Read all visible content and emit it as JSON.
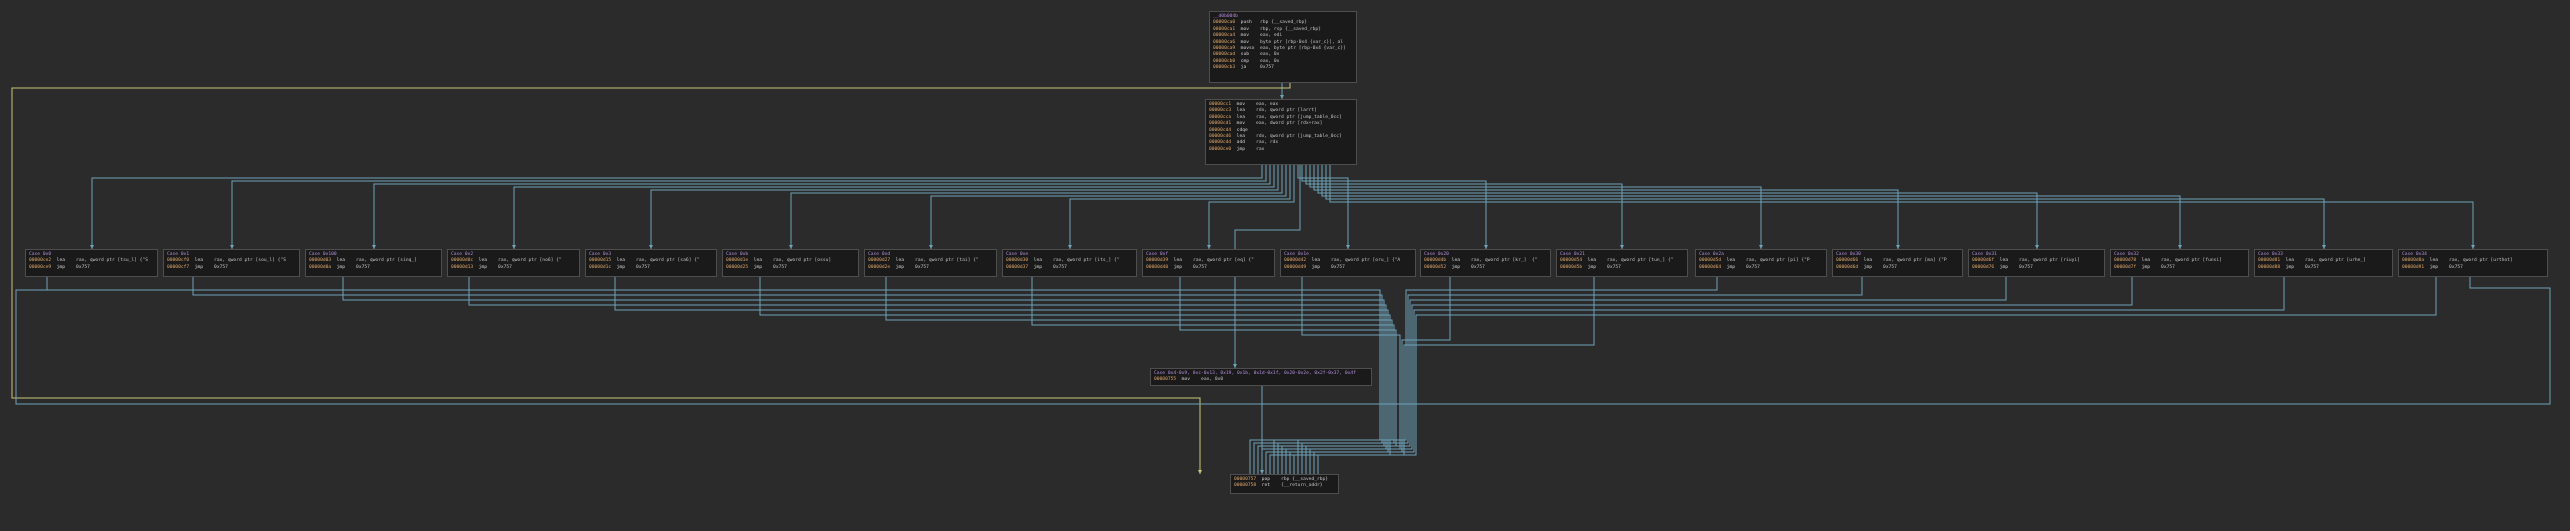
{
  "theme": {
    "background": "#2b2b2b",
    "block_background": "#1a1a1a",
    "block_border": "#4e4e4e",
    "edge_branch_color": "#6fa3b8",
    "edge_default_color": "#c8c87a",
    "address_color": "#e0a86a",
    "label_color": "#b58ee0",
    "variable_color": "#d07050"
  },
  "blocks": {
    "entry": {
      "label": "__d0b004b",
      "lines": [
        {
          "addr": "00000ca0",
          "mn": "push",
          "op": "rbp {__saved_rbp}"
        },
        {
          "addr": "00000ca1",
          "mn": "mov",
          "op": "rbp, rsp {__saved_rbp}"
        },
        {
          "addr": "00000ca4",
          "mn": "mov",
          "op": "eax, edi"
        },
        {
          "addr": "00000ca6",
          "mn": "mov",
          "op": "byte ptr [rbp-0x4 {var_c}], al"
        },
        {
          "addr": "00000ca9",
          "mn": "movsx",
          "op": "eax, byte ptr [rbp-0x4 {var_c}]"
        },
        {
          "addr": "00000cad",
          "mn": "sub",
          "op": "eax, 0x"
        },
        {
          "addr": "00000cb0",
          "mn": "cmp",
          "op": "eax, 0x"
        },
        {
          "addr": "00000cb3",
          "mn": "ja",
          "op": "0x757"
        }
      ]
    },
    "dispatch": {
      "label": "",
      "lines": [
        {
          "addr": "00000cc1",
          "mn": "mov",
          "op": "eax, eax"
        },
        {
          "addr": "00000cc3",
          "mn": "lea",
          "op": "rdx, qword ptr [larrt]"
        },
        {
          "addr": "00000cca",
          "mn": "lea",
          "op": "rax, qword ptr [jump_table_0cc]"
        },
        {
          "addr": "00000cd1",
          "mn": "mov",
          "op": "eax, dword ptr [rdx+rax]"
        },
        {
          "addr": "00000cd4",
          "mn": "cdqe",
          "op": ""
        },
        {
          "addr": "00000cd6",
          "mn": "lea",
          "op": "rdx, qword ptr [jump_table_0cc]"
        },
        {
          "addr": "00000cdd",
          "mn": "add",
          "op": "rax, rdx"
        },
        {
          "addr": "00000ce0",
          "mn": "jmp",
          "op": "rax"
        }
      ]
    },
    "merge": {
      "label": "Case 0x4-0x9, 0xc-0x13, 0x19, 0x1b, 0x1d-0x1f, 0x20-0x2e, 0x2f-0x37, 0x4f",
      "lines": [
        {
          "addr": "00000755",
          "mn": "mov",
          "op": "eax, 0x0"
        }
      ]
    },
    "exit": {
      "label": "",
      "lines": [
        {
          "addr": "00000757",
          "mn": "pop",
          "op": "rbp {__saved_rbp}"
        },
        {
          "addr": "00000758",
          "mn": "ret",
          "op": "{__return_addr}"
        }
      ]
    }
  },
  "cases": [
    {
      "label": "Case 0x0",
      "lines": [
        {
          "addr": "00000ce2",
          "mn": "lea",
          "op": "rax, qword ptr [tsu_l] {\"S"
        },
        {
          "addr": "00000ce9",
          "mn": "jmp",
          "op": "0x757"
        }
      ]
    },
    {
      "label": "Case 0x1",
      "lines": [
        {
          "addr": "00000cf0",
          "mn": "lea",
          "op": "rax, qword ptr [sou_l] {\"S"
        },
        {
          "addr": "00000cf7",
          "mn": "jmp",
          "op": "0x757"
        }
      ]
    },
    {
      "label": "Case 0x100",
      "lines": [
        {
          "addr": "00000d03",
          "mn": "lea",
          "op": "rax, qword ptr [sinq_]"
        },
        {
          "addr": "00000d0a",
          "mn": "jmp",
          "op": "0x757"
        }
      ]
    },
    {
      "label": "Case 0x2",
      "lines": [
        {
          "addr": "00000d0c",
          "mn": "lea",
          "op": "rax, qword ptr [no6] {\""
        },
        {
          "addr": "00000d13",
          "mn": "jmp",
          "op": "0x757"
        }
      ]
    },
    {
      "label": "Case 0x3",
      "lines": [
        {
          "addr": "00000d15",
          "mn": "lea",
          "op": "rax, qword ptr [sa6] {\""
        },
        {
          "addr": "00000d1c",
          "mn": "jmp",
          "op": "0x757"
        }
      ]
    },
    {
      "label": "Case 0xb",
      "lines": [
        {
          "addr": "00000d1e",
          "mn": "lea",
          "op": "rax, qword ptr [ossu]"
        },
        {
          "addr": "00000d25",
          "mn": "jmp",
          "op": "0x757"
        }
      ]
    },
    {
      "label": "Case 0xd",
      "lines": [
        {
          "addr": "00000d27",
          "mn": "lea",
          "op": "rax, qword ptr [tai] {\""
        },
        {
          "addr": "00000d2e",
          "mn": "jmp",
          "op": "0x757"
        }
      ]
    },
    {
      "label": "Case 0xe",
      "lines": [
        {
          "addr": "00000d30",
          "mn": "lea",
          "op": "rax, qword ptr [its_] {\""
        },
        {
          "addr": "00000d37",
          "mn": "jmp",
          "op": "0x757"
        }
      ]
    },
    {
      "label": "Case 0xf",
      "lines": [
        {
          "addr": "00000d39",
          "mn": "lea",
          "op": "rax, qword ptr [eq] {\""
        },
        {
          "addr": "00000d40",
          "mn": "jmp",
          "op": "0x757"
        }
      ]
    },
    {
      "label": "Case 0x1e",
      "lines": [
        {
          "addr": "00000d42",
          "mn": "lea",
          "op": "rax, qword ptr [oru_] {\"A"
        },
        {
          "addr": "00000d49",
          "mn": "jmp",
          "op": "0x757"
        }
      ]
    },
    {
      "label": "Case 0x20",
      "lines": [
        {
          "addr": "00000d4b",
          "mn": "lea",
          "op": "rax, qword ptr [kr_]  {\""
        },
        {
          "addr": "00000d52",
          "mn": "jmp",
          "op": "0x757"
        }
      ]
    },
    {
      "label": "Case 0x21",
      "lines": [
        {
          "addr": "00000d54",
          "mn": "lea",
          "op": "rax, qword ptr [tun_] {\""
        },
        {
          "addr": "00000d5b",
          "mn": "jmp",
          "op": "0x757"
        }
      ]
    },
    {
      "label": "Case 0x2a",
      "lines": [
        {
          "addr": "00000d5d",
          "mn": "lea",
          "op": "rax, qword ptr [pi] {\"P"
        },
        {
          "addr": "00000d64",
          "mn": "jmp",
          "op": "0x757"
        }
      ]
    },
    {
      "label": "Case 0x30",
      "lines": [
        {
          "addr": "00000d66",
          "mn": "lea",
          "op": "rax, qword ptr [ma] {\"P"
        },
        {
          "addr": "00000d6d",
          "mn": "jmp",
          "op": "0x757"
        }
      ]
    },
    {
      "label": "Case 0x31",
      "lines": [
        {
          "addr": "00000d6f",
          "mn": "lea",
          "op": "rax, qword ptr [riuyi]"
        },
        {
          "addr": "00000d76",
          "mn": "jmp",
          "op": "0x757"
        }
      ]
    },
    {
      "label": "Case 0x32",
      "lines": [
        {
          "addr": "00000d78",
          "mn": "lea",
          "op": "rax, qword ptr [funsi]"
        },
        {
          "addr": "00000d7f",
          "mn": "jmp",
          "op": "0x757"
        }
      ]
    },
    {
      "label": "Case 0x33",
      "lines": [
        {
          "addr": "00000d81",
          "mn": "lea",
          "op": "rax, qword ptr [urhe_]"
        },
        {
          "addr": "00000d88",
          "mn": "jmp",
          "op": "0x757"
        }
      ]
    },
    {
      "label": "Case 0x34",
      "lines": [
        {
          "addr": "00000d8a",
          "mn": "lea",
          "op": "rax, qword ptr [urthot]"
        },
        {
          "addr": "00000d91",
          "mn": "jmp",
          "op": "0x757"
        }
      ]
    }
  ]
}
